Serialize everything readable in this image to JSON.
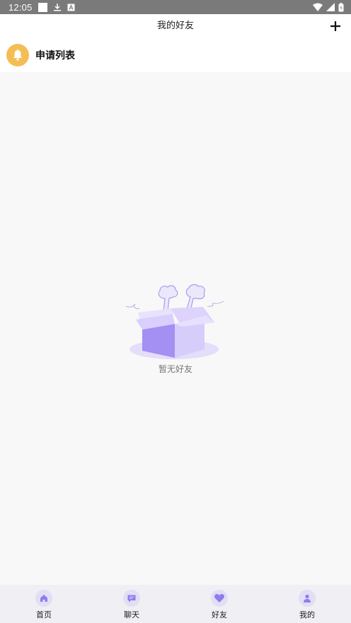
{
  "status_bar": {
    "time": "12:05"
  },
  "header": {
    "title": "我的好友"
  },
  "apply_row": {
    "label": "申请列表"
  },
  "empty": {
    "text": "暂无好友"
  },
  "nav": {
    "items": [
      {
        "label": "首页",
        "icon": "home-icon"
      },
      {
        "label": "聊天",
        "icon": "chat-icon"
      },
      {
        "label": "好友",
        "icon": "heart-icon"
      },
      {
        "label": "我的",
        "icon": "user-icon"
      }
    ]
  },
  "colors": {
    "accent": "#8e7cf0",
    "bell_avatar": "#f4be55",
    "status_bar": "#7a7a7a",
    "nav_bg": "#efeff4"
  }
}
